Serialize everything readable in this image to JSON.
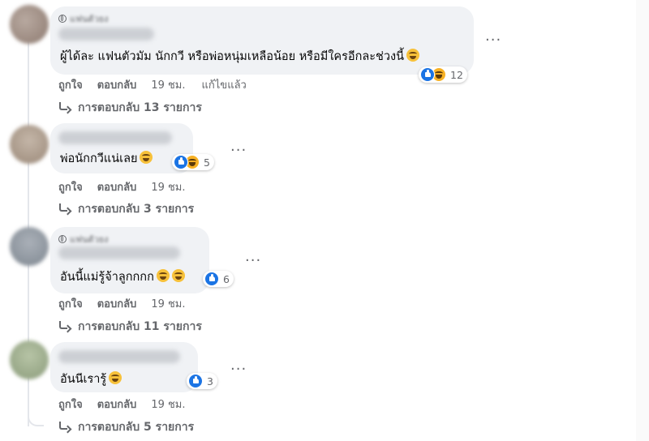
{
  "comments": [
    {
      "meta_label": "แฟนตัวยง",
      "text": "ผู้ได้ละ แฟนตัวมัม นักกวี หรือพ่อหนุ่มเหลือน้อย หรือมีใครอีกละช่วงนี้",
      "reaction_count": "12",
      "reactions": [
        "like",
        "haha"
      ],
      "like_label": "ถูกใจ",
      "reply_label": "ตอบกลับ",
      "time": "19 ชม.",
      "edited_label": "แก้ไขแล้ว",
      "replies_label": "การตอบกลับ 13 รายการ"
    },
    {
      "text": "พ่อนักกวีแน่เลย",
      "reaction_count": "5",
      "reactions": [
        "like",
        "haha"
      ],
      "like_label": "ถูกใจ",
      "reply_label": "ตอบกลับ",
      "time": "19 ชม.",
      "replies_label": "การตอบกลับ 3 รายการ"
    },
    {
      "meta_label": "แฟนตัวยง",
      "text": "อันนี้แม่รู้จ้าลูกกกก",
      "reaction_count": "6",
      "reactions": [
        "like"
      ],
      "like_label": "ถูกใจ",
      "reply_label": "ตอบกลับ",
      "time": "19 ชม.",
      "replies_label": "การตอบกลับ 11 รายการ"
    },
    {
      "text": "อันนีเรารู้",
      "reaction_count": "3",
      "reactions": [
        "like"
      ],
      "like_label": "ถูกใจ",
      "reply_label": "ตอบกลับ",
      "time": "19 ชม.",
      "replies_label": "การตอบกลับ 5 รายการ"
    }
  ],
  "more_label": "...",
  "colors": {
    "bubble": "#f0f2f5",
    "secondary_text": "#65676b",
    "like_blue": "#1b74e4",
    "haha_yellow": "#f7b125"
  },
  "icons": {
    "like": "thumbs-up-icon",
    "haha": "laughing-face-icon",
    "reply": "reply-arrow-icon",
    "more": "more-dots-icon",
    "privacy": "globe-icon"
  }
}
